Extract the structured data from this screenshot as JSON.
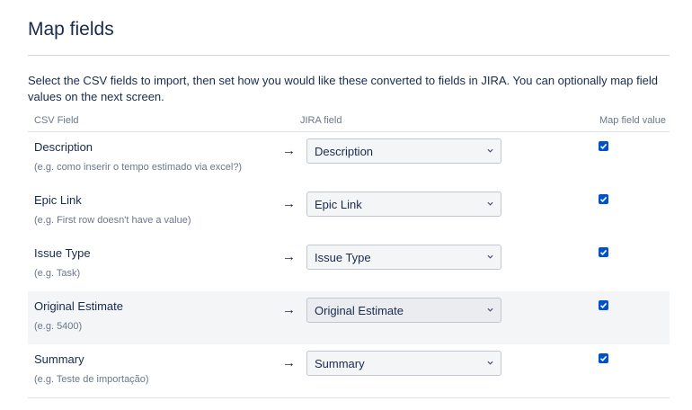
{
  "page": {
    "title": "Map fields",
    "intro": "Select the CSV fields to import, then set how you would like these converted to fields in JIRA. You can optionally map field values on the next screen."
  },
  "table": {
    "headers": {
      "csv_field": "CSV Field",
      "jira_field": "JIRA field",
      "map_value": "Map field value"
    },
    "arrow": "→",
    "rows": [
      {
        "csv_field": "Description",
        "example": "(e.g. como inserir o tempo estimado via excel?)",
        "jira_field": "Description",
        "map_value": true
      },
      {
        "csv_field": "Epic Link",
        "example": "(e.g. First row doesn't have a value)",
        "jira_field": "Epic Link",
        "map_value": true
      },
      {
        "csv_field": "Issue Type",
        "example": "(e.g. Task)",
        "jira_field": "Issue Type",
        "map_value": true
      },
      {
        "csv_field": "Original Estimate",
        "example": "(e.g. 5400)",
        "jira_field": "Original Estimate",
        "map_value": true
      },
      {
        "csv_field": "Summary",
        "example": "(e.g. Teste de importação)",
        "jira_field": "Summary",
        "map_value": true
      }
    ]
  },
  "colors": {
    "checkbox": "#0052cc",
    "text": "#172b4d",
    "muted": "#6b778c"
  },
  "icons": {
    "select_chevron": "chevron-down-icon",
    "checkbox_check": "check-icon"
  }
}
